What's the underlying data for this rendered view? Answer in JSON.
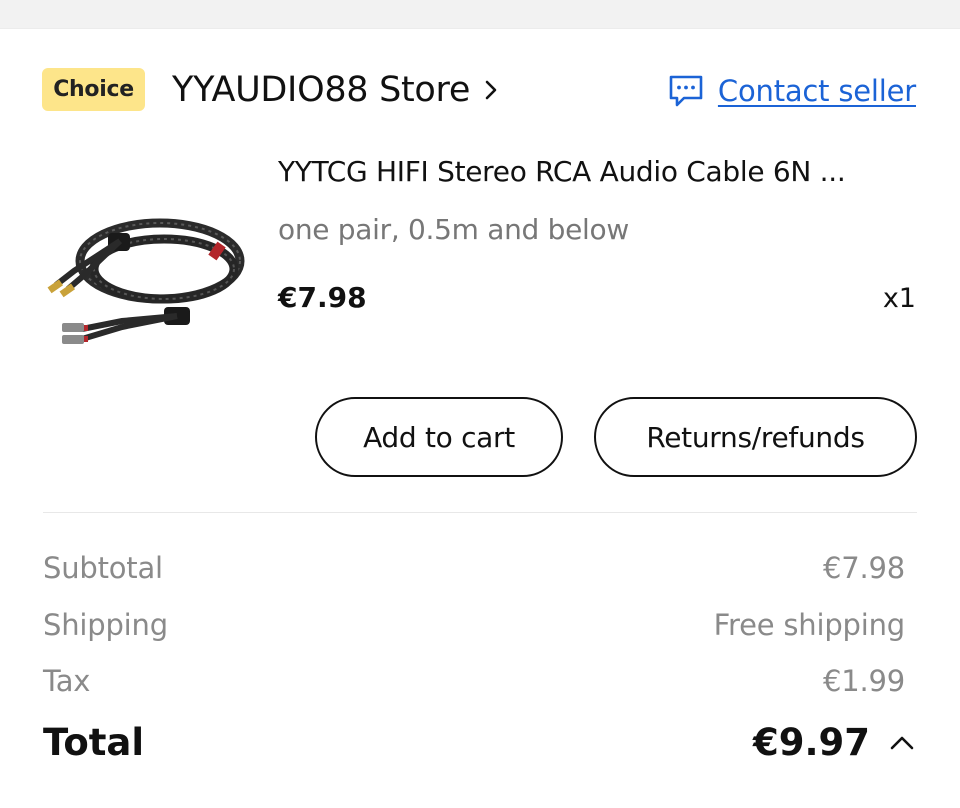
{
  "store": {
    "badge": "Choice",
    "name": "YYAUDIO88 Store",
    "contact_label": "Contact seller"
  },
  "product": {
    "title": "YYTCG HIFI Stereo RCA Audio Cable 6N ...",
    "variant": "one pair, 0.5m and below",
    "price": "€7.98",
    "quantity": "x1"
  },
  "actions": {
    "add_to_cart": "Add to cart",
    "returns": "Returns/refunds"
  },
  "summary": {
    "subtotal_label": "Subtotal",
    "subtotal_value": "€7.98",
    "shipping_label": "Shipping",
    "shipping_value": "Free shipping",
    "tax_label": "Tax",
    "tax_value": "€1.99",
    "total_label": "Total",
    "total_value": "€9.97"
  },
  "icons": {
    "store_chevron": "chevron-right-icon",
    "contact": "chat-bubble-icon",
    "total_toggle": "chevron-up-icon"
  },
  "colors": {
    "badge_bg": "#fde58a",
    "link": "#1b63d6",
    "muted_text": "#8a8a8a"
  }
}
